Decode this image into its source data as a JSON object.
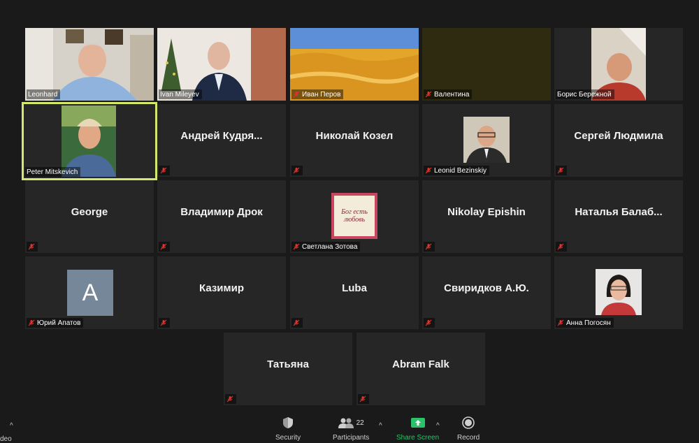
{
  "participants_count": "22",
  "tiles": [
    {
      "id": "leonhard",
      "label": "Leonhard"
    },
    {
      "id": "ivan-mileyev",
      "label": "Ivan Mileyev"
    },
    {
      "id": "ivan-perov",
      "label": "Иван Перов"
    },
    {
      "id": "valentina",
      "label": "Валентина"
    },
    {
      "id": "boris",
      "label": "Борис Бережной"
    },
    {
      "id": "peter",
      "label": "Peter Mitskevich"
    },
    {
      "id": "andrey",
      "center": "Андрей  Кудря..."
    },
    {
      "id": "nikolay-kozel",
      "center": "Николай Козел"
    },
    {
      "id": "leonid",
      "label": "Leonid Bezinskiy"
    },
    {
      "id": "sergey",
      "center": "Сергей Людмила"
    },
    {
      "id": "george",
      "center": "George"
    },
    {
      "id": "vladimir",
      "center": "Владимир Дрок"
    },
    {
      "id": "svetlana",
      "label": "Светлана Зотова",
      "card_text": "Бог есть любовь"
    },
    {
      "id": "nikolay-epishin",
      "center": "Nikolay Epishin"
    },
    {
      "id": "natalya",
      "center": "Наталья  Балаб..."
    },
    {
      "id": "yuriy",
      "label": "Юрий Апатов",
      "avatar": "A"
    },
    {
      "id": "kazimir",
      "center": "Казимир"
    },
    {
      "id": "luba",
      "center": "Luba"
    },
    {
      "id": "sviridkov",
      "center": "Свиридков А.Ю."
    },
    {
      "id": "anna",
      "label": "Анна Погосян"
    },
    {
      "id": "tatyana",
      "center": "Татьяна"
    },
    {
      "id": "abram",
      "center": "Abram Falk"
    }
  ],
  "toolbar": {
    "video_label": "deo",
    "security": "Security",
    "participants": "Participants",
    "share_screen": "Share Screen",
    "record": "Record"
  },
  "colors": {
    "background": "#1a1a1a",
    "tile": "#262626",
    "speaking_border": "#d6e86b",
    "share_green": "#2ac36a",
    "mute_red": "#e0332e"
  }
}
